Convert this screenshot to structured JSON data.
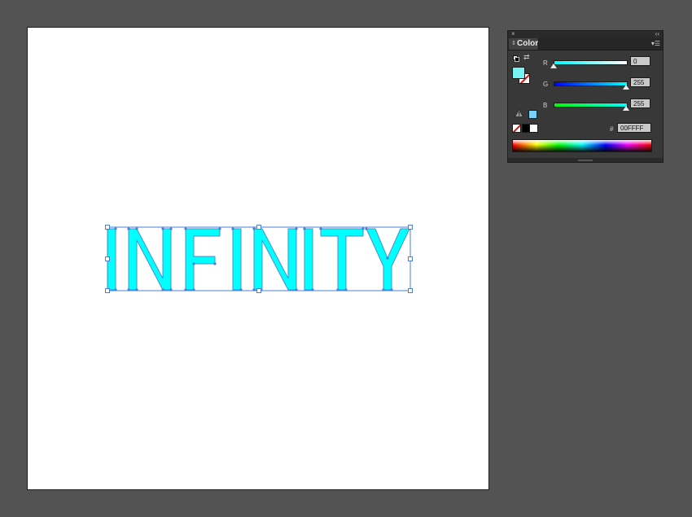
{
  "artboard": {
    "text": "INFINITY",
    "fill_color": "#00FFFF",
    "stroke_color": "#4A8FD0",
    "selection_color": "#4A7FD8"
  },
  "color_panel": {
    "close_glyph": "×",
    "collapse_glyph": "‹‹",
    "tab_arrows": "⇕",
    "tab_label": "Color",
    "menu_glyph": "▾☰",
    "swap_glyph": "⇄",
    "channels": [
      {
        "label": "R",
        "value": "0",
        "level": 0,
        "gradient": "linear-gradient(to right,#00ffff,#ffffff)"
      },
      {
        "label": "G",
        "value": "255",
        "level": 1,
        "gradient": "linear-gradient(to right,#0000ff,#00ffff)"
      },
      {
        "label": "B",
        "value": "255",
        "level": 1,
        "gradient": "linear-gradient(to right,#00ff00,#00ffff)"
      }
    ],
    "hash_label": "#",
    "hex_value": "00FFFF",
    "fill_color": "#77F3F6"
  }
}
